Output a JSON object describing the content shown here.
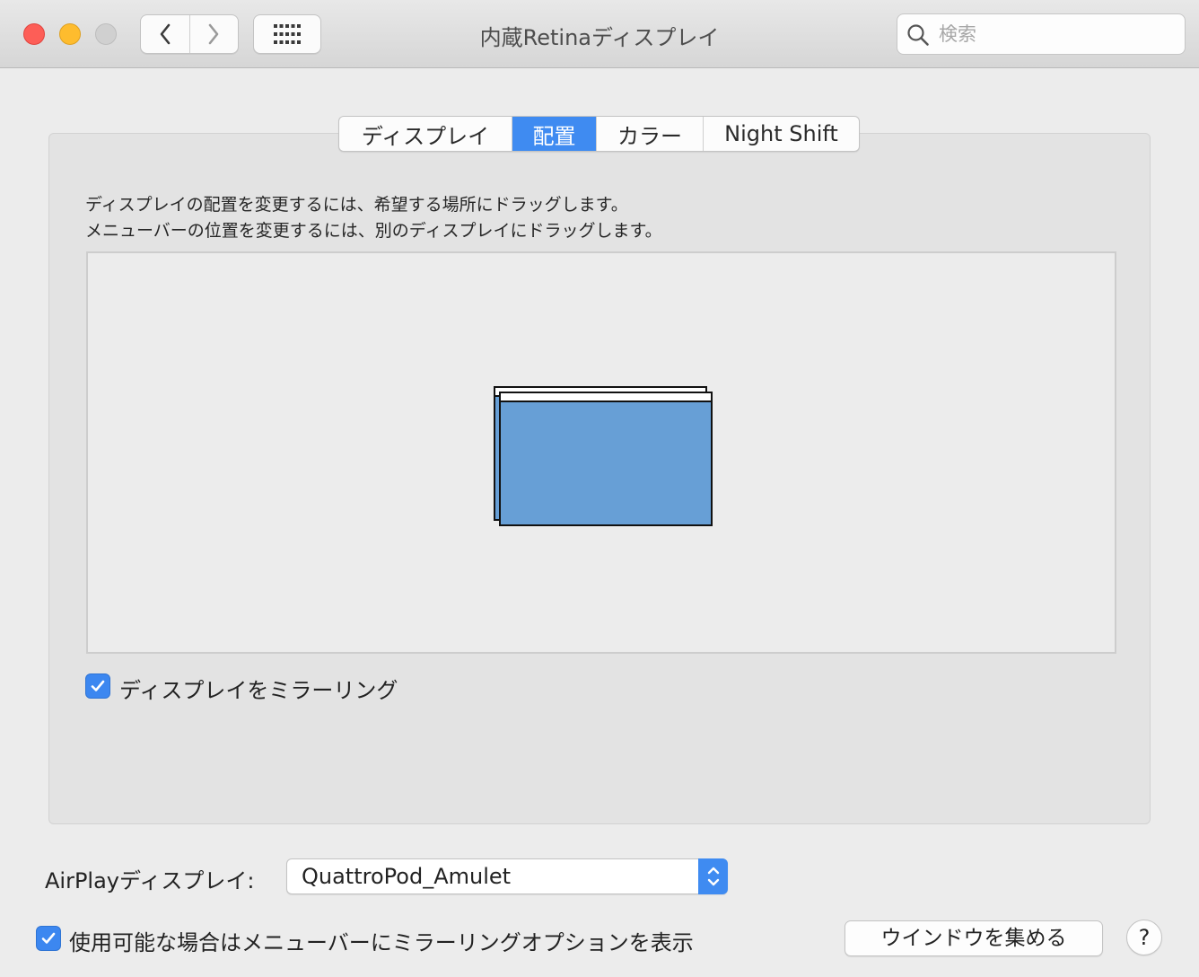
{
  "window": {
    "title": "内蔵Retinaディスプレイ"
  },
  "toolbar": {
    "back_icon": "chevron-left-icon",
    "forward_icon": "chevron-right-icon",
    "show_all_icon": "grid-icon"
  },
  "search": {
    "placeholder": "検索",
    "value": "",
    "icon": "search-icon"
  },
  "tabs": [
    {
      "label": "ディスプレイ",
      "active": false
    },
    {
      "label": "配置",
      "active": true
    },
    {
      "label": "カラー",
      "active": false
    },
    {
      "label": "Night Shift",
      "active": false
    }
  ],
  "arrangement": {
    "instruction_1": "ディスプレイの配置を変更するには、希望する場所にドラッグします。",
    "instruction_2": "メニューバーの位置を変更するには、別のディスプレイにドラッグします。"
  },
  "mirror": {
    "label": "ディスプレイをミラーリング",
    "checked": true
  },
  "airplay": {
    "label": "AirPlayディスプレイ:",
    "selected": "QuattroPod_Amulet"
  },
  "menubar_option": {
    "label": "使用可能な場合はメニューバーにミラーリングオプションを表示",
    "checked": true
  },
  "buttons": {
    "gather_windows": "ウインドウを集める",
    "help": "?"
  },
  "colors": {
    "accent": "#3f8bf1",
    "display_fill": "#679fd6",
    "close": "#fd5e57",
    "minimize": "#febc2e",
    "zoom_disabled": "#d0d0d0"
  }
}
